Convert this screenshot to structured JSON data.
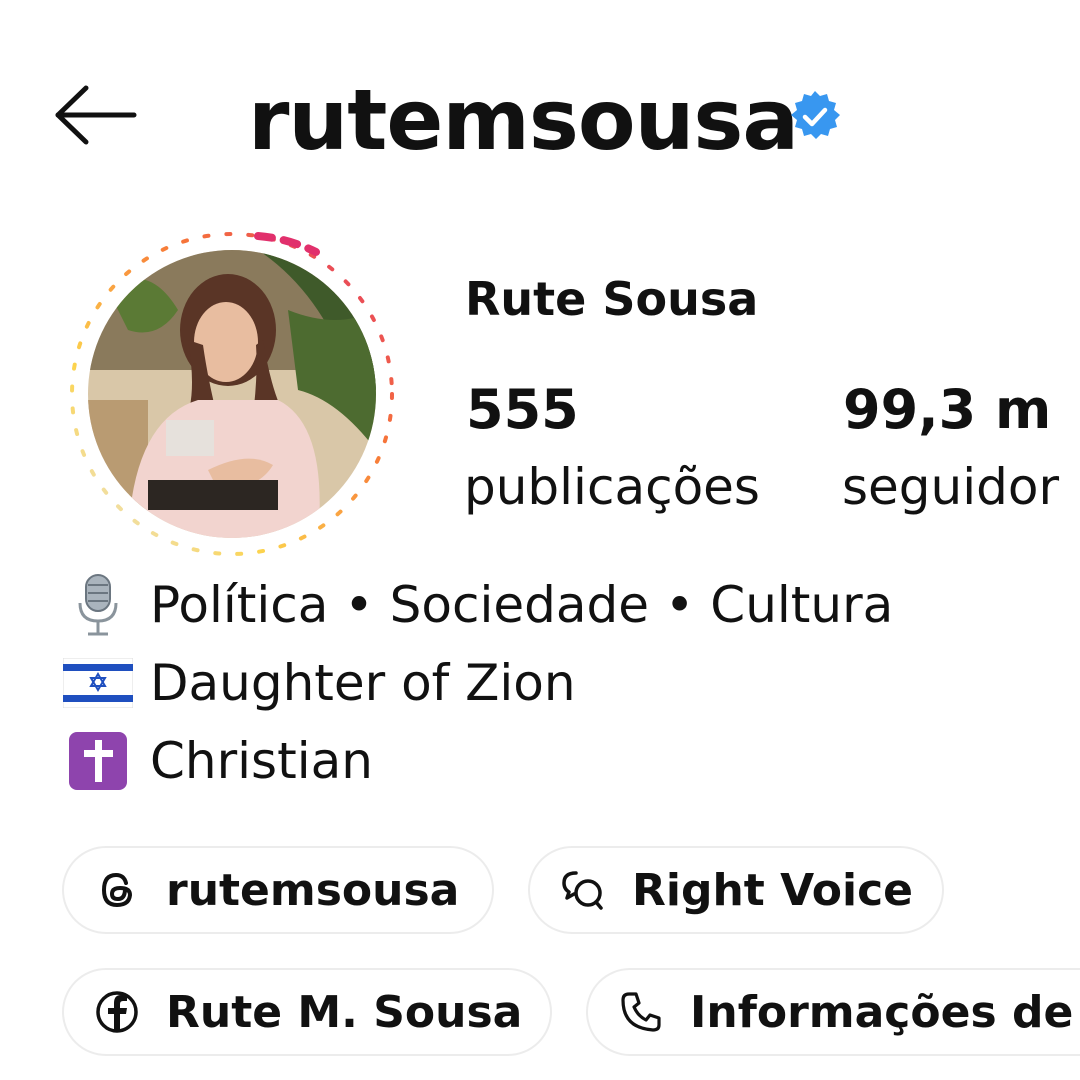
{
  "header": {
    "username": "rutemsousa",
    "verified_color": "#3897f0"
  },
  "profile": {
    "full_name": "Rute Sousa",
    "stats": [
      {
        "value": "555",
        "label": "publicações"
      },
      {
        "value": "99,3 m",
        "label": "seguidor"
      }
    ]
  },
  "bio": {
    "lines": [
      {
        "icon": "microphone-icon",
        "text": "Política • Sociedade • Cultura"
      },
      {
        "icon": "israel-flag-icon",
        "text": "Daughter of Zion"
      },
      {
        "icon": "latin-cross-icon",
        "text": "Christian"
      }
    ]
  },
  "links": [
    {
      "icon": "threads-icon",
      "label": "rutemsousa"
    },
    {
      "icon": "chat-bubbles-icon",
      "label": "Right Voice"
    },
    {
      "icon": "facebook-icon",
      "label": "Rute M. Sousa"
    },
    {
      "icon": "phone-icon",
      "label": "Informações de c"
    }
  ],
  "colors": {
    "text": "#111111",
    "pill_border": "#ececec",
    "story_ring_start": "#e1306c",
    "story_ring_end": "#fcd34d",
    "cross_bg": "#8e44ad",
    "flag_blue": "#1f4fbf"
  }
}
